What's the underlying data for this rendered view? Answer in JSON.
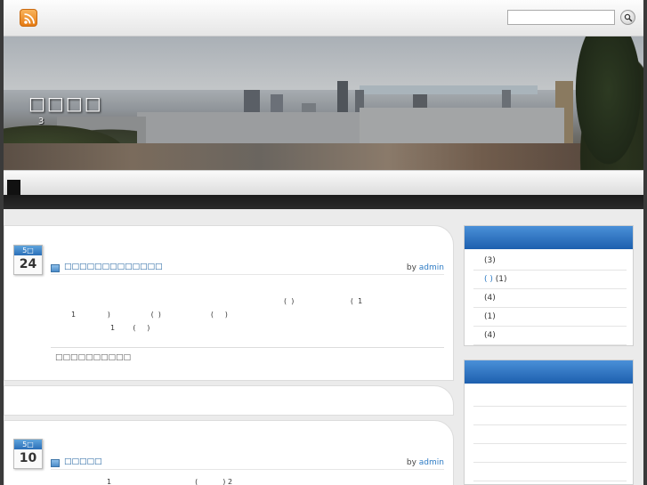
{
  "search": {
    "placeholder": "",
    "value": ""
  },
  "header": {
    "site_title": "□□□□",
    "site_description": "3"
  },
  "posts": [
    {
      "month": "5□",
      "day": "24",
      "title": "□□□□□□□□□□□□□",
      "by": "by",
      "author": "admin",
      "lines": [
        "(  )                         (  1",
        "1              )                  (  )                      (     )",
        "1        (     )"
      ],
      "tags": "□□□□□□□□□□"
    },
    {
      "month": "5□",
      "day": "10",
      "title": "□□□□□",
      "by": "by",
      "author": "admin",
      "lines": [
        "1                                     (           ) 2"
      ]
    }
  ],
  "sidebar": {
    "categories": [
      {
        "label": "(3)",
        "link": ""
      },
      {
        "label": "(1)",
        "link": "(  )"
      },
      {
        "label": "(4)",
        "link": ""
      },
      {
        "label": "(1)",
        "link": ""
      },
      {
        "label": "(4)",
        "link": ""
      }
    ]
  },
  "colors": {
    "accent_blue": "#2d7bc4",
    "widget_header": "#1d5fae",
    "rss_orange": "#e57a12"
  }
}
